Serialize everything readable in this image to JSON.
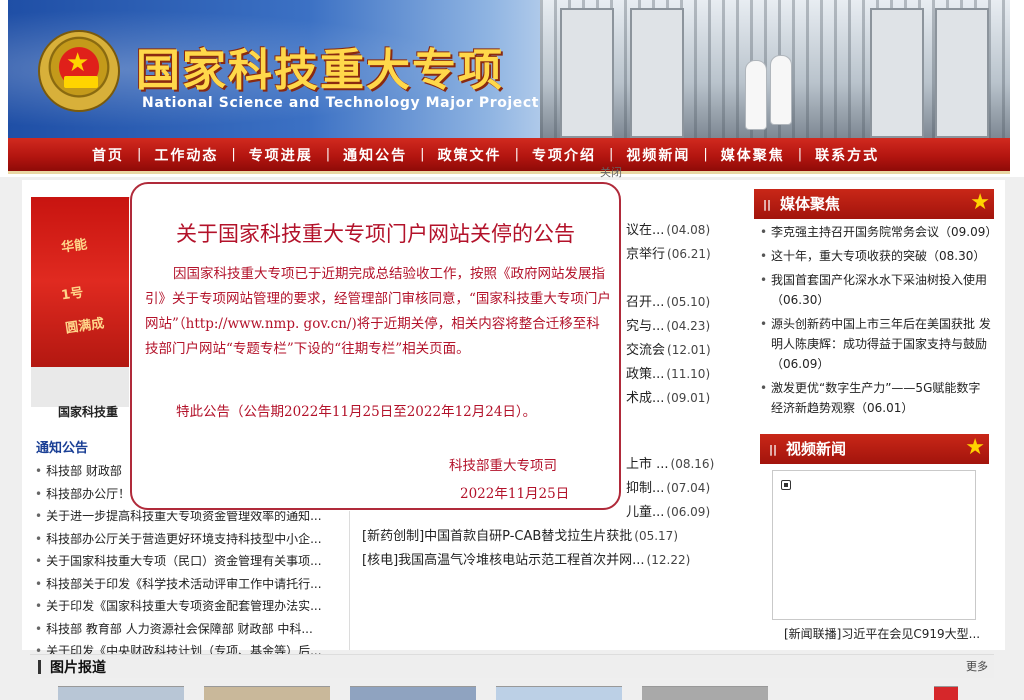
{
  "header": {
    "title": "国家科技重大专项",
    "subtitle": "National Science and Technology Major Project"
  },
  "nav": {
    "items": [
      "首页",
      "工作动态",
      "专项进展",
      "通知公告",
      "政策文件",
      "专项介绍",
      "视频新闻",
      "媒体聚焦",
      "联系方式"
    ]
  },
  "photo": {
    "caption": "国家科技重",
    "lines": [
      "华能",
      "1号",
      "圆满成"
    ]
  },
  "notices": {
    "title": "通知公告",
    "items": [
      "科技部 财政部",
      "科技部办公厅！",
      "关于进一步提高科技重大专项资金管理效率的通知...",
      "科技部办公厅关于营造更好环境支持科技型中小企...",
      "关于国家科技重大专项（民口）资金管理有关事项...",
      "科技部关于印发《科学技术活动评审工作中请托行...",
      "关于印发《国家科技重大专项资金配套管理办法实...",
      "科技部 教育部 人力资源社会保障部 财政部 中科...",
      "关于印发《中央财政科技计划（专项、基金等）后..."
    ]
  },
  "progress_top": [
    {
      "text": "议在...",
      "date": "(04.08)"
    },
    {
      "text": "京举行",
      "date": "(06.21)"
    },
    {
      "text": "",
      "date": ""
    },
    {
      "text": "召开...",
      "date": "(05.10)"
    },
    {
      "text": "究与...",
      "date": "(04.23)"
    },
    {
      "text": "交流会",
      "date": "(12.01)"
    },
    {
      "text": "政策...",
      "date": "(11.10)"
    },
    {
      "text": "术成...",
      "date": "(09.01)"
    }
  ],
  "progress_bottom": [
    {
      "text": "上市 ...",
      "date": "(08.16)"
    },
    {
      "text": "抑制...",
      "date": "(07.04)"
    },
    {
      "text": "儿童...",
      "date": "(06.09)"
    },
    {
      "text": "[新药创制]中国首款自研P-CAB替戈拉生片获批",
      "date": "(05.17)"
    },
    {
      "text": "[核电]我国高温气冷堆核电站示范工程首次并网...",
      "date": "(12.22)"
    }
  ],
  "peek": "关闭",
  "media": {
    "title": "媒体聚焦",
    "items": [
      "李克强主持召开国务院常务会议（09.09）",
      "这十年，重大专项收获的突破（08.30）",
      "我国首套国产化深水水下采油树投入使用（06.30）",
      "源头创新药中国上市三年后在美国获批 发明人陈庚辉：成功得益于国家支持与鼓励（06.09）",
      "激发更优“数字生产力”——5G赋能数字经济新趋势观察（06.01）"
    ]
  },
  "video": {
    "title": "视频新闻",
    "caption": "[新闻联播]习近平在会见C919大型..."
  },
  "pictures": {
    "title": "图片报道",
    "more": "更多"
  },
  "modal": {
    "title": "关于国家科技重大专项门户网站关停的公告",
    "body": "因国家科技重大专项已于近期完成总结验收工作，按照《政府网站发展指引》关于专项网站管理的要求，经管理部门审核同意，“国家科技重大专项门户网站”（http://www.nmp. gov.cn/)将于近期关停，相关内容将整合迁移至科技部门户网站“专题专栏”下设的“往期专栏”相关页面。",
    "note": "特此公告（公告期2022年11月25日至2022年12月24日）。",
    "signer": "科技部重大专项司",
    "date": "2022年11月25日"
  },
  "colors": {
    "nav_red": "#b41510",
    "modal_red": "#b3122a",
    "title_gold": "#ffd84a",
    "link_blue": "#1a3f95"
  },
  "icons": [
    "national-emblem-icon",
    "star-icon",
    "play-icon"
  ]
}
